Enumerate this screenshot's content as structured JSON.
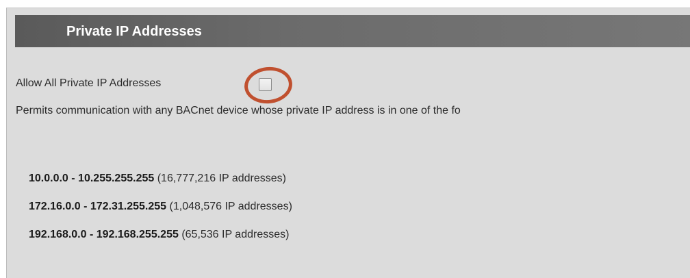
{
  "section": {
    "title": "Private IP Addresses"
  },
  "allow_private": {
    "label": "Allow All Private IP Addresses",
    "checked": false
  },
  "description": "Permits communication with any BACnet device whose private IP address is in one of the fo",
  "ranges": [
    {
      "range": "10.0.0.0 - 10.255.255.255",
      "count": "(16,777,216 IP addresses)"
    },
    {
      "range": "172.16.0.0 - 172.31.255.255",
      "count": "(1,048,576 IP addresses)"
    },
    {
      "range": "192.168.0.0 - 192.168.255.255",
      "count": "(65,536 IP addresses)"
    }
  ],
  "colors": {
    "header_bg": "#5a5a5a",
    "panel_bg": "#dcdcdc",
    "highlight": "#c0502f"
  }
}
